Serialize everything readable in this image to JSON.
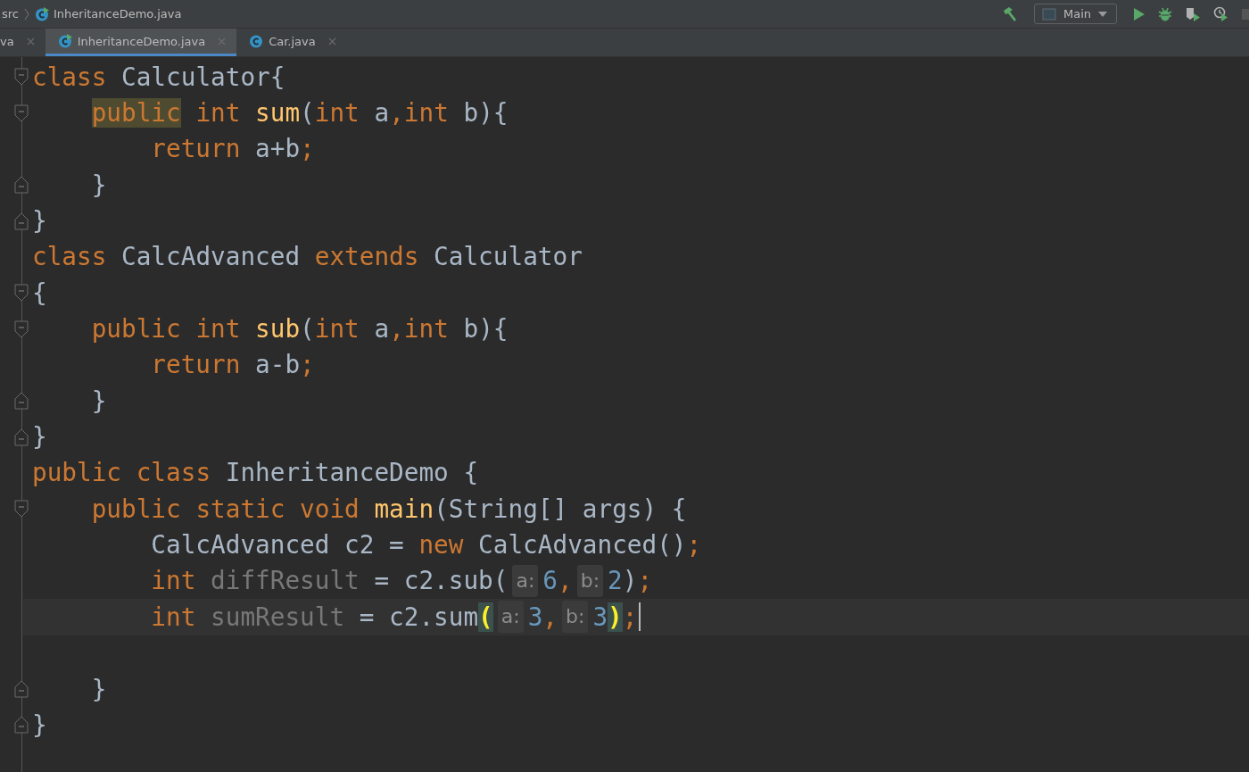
{
  "breadcrumb": [
    {
      "label": "src",
      "kind": "folder"
    },
    {
      "label": "InheritanceDemo.java",
      "kind": "main-class"
    }
  ],
  "run_config": {
    "label": "Main"
  },
  "tabs": [
    {
      "label": "va",
      "kind": "file",
      "selected": false
    },
    {
      "label": "InheritanceDemo.java",
      "kind": "main-class",
      "selected": true
    },
    {
      "label": "Car.java",
      "kind": "class",
      "selected": false
    }
  ],
  "lines": [
    {
      "fold_start": true,
      "fold_end": false,
      "current": false,
      "caret": false,
      "tokens": [
        {
          "kind": "kw",
          "t": "class"
        },
        {
          "kind": "plain",
          "t": " Calculator{"
        }
      ]
    },
    {
      "fold_start": true,
      "fold_end": false,
      "current": false,
      "caret": false,
      "tokens": [
        {
          "kind": "kw-highlight",
          "t": "    public"
        },
        {
          "kind": "kw",
          "t": " int"
        },
        {
          "kind": "method",
          "t": " sum"
        },
        {
          "kind": "plain",
          "t": "("
        },
        {
          "kind": "kw",
          "t": "int"
        },
        {
          "kind": "plain",
          "t": " a"
        },
        {
          "kind": "kw",
          "t": ","
        },
        {
          "kind": "kw",
          "t": "int"
        },
        {
          "kind": "plain",
          "t": " b){"
        }
      ]
    },
    {
      "fold_start": false,
      "fold_end": false,
      "current": false,
      "caret": false,
      "tokens": [
        {
          "kind": "kw",
          "t": "        return"
        },
        {
          "kind": "plain",
          "t": " a+b"
        },
        {
          "kind": "kw",
          "t": ";"
        }
      ]
    },
    {
      "fold_start": false,
      "fold_end": true,
      "current": false,
      "caret": false,
      "tokens": [
        {
          "kind": "plain",
          "t": "    }"
        }
      ]
    },
    {
      "fold_start": false,
      "fold_end": true,
      "current": false,
      "caret": false,
      "tokens": [
        {
          "kind": "plain",
          "t": "}"
        }
      ]
    },
    {
      "fold_start": false,
      "fold_end": false,
      "current": false,
      "caret": false,
      "tokens": [
        {
          "kind": "kw",
          "t": "class"
        },
        {
          "kind": "plain",
          "t": " CalcAdvanced"
        },
        {
          "kind": "kw",
          "t": " extends"
        },
        {
          "kind": "plain",
          "t": " Calculator"
        }
      ]
    },
    {
      "fold_start": true,
      "fold_end": false,
      "current": false,
      "caret": false,
      "tokens": [
        {
          "kind": "plain",
          "t": "{"
        }
      ]
    },
    {
      "fold_start": true,
      "fold_end": false,
      "current": false,
      "caret": false,
      "tokens": [
        {
          "kind": "kw",
          "t": "    public"
        },
        {
          "kind": "kw",
          "t": " int"
        },
        {
          "kind": "method",
          "t": " sub"
        },
        {
          "kind": "plain",
          "t": "("
        },
        {
          "kind": "kw",
          "t": "int"
        },
        {
          "kind": "plain",
          "t": " a"
        },
        {
          "kind": "kw",
          "t": ","
        },
        {
          "kind": "kw",
          "t": "int"
        },
        {
          "kind": "plain",
          "t": " b){"
        }
      ]
    },
    {
      "fold_start": false,
      "fold_end": false,
      "current": false,
      "caret": false,
      "tokens": [
        {
          "kind": "kw",
          "t": "        return"
        },
        {
          "kind": "plain",
          "t": " a-b"
        },
        {
          "kind": "kw",
          "t": ";"
        }
      ]
    },
    {
      "fold_start": false,
      "fold_end": true,
      "current": false,
      "caret": false,
      "tokens": [
        {
          "kind": "plain",
          "t": "    }"
        }
      ]
    },
    {
      "fold_start": false,
      "fold_end": true,
      "current": false,
      "caret": false,
      "tokens": [
        {
          "kind": "plain",
          "t": "}"
        }
      ]
    },
    {
      "fold_start": false,
      "fold_end": false,
      "current": false,
      "caret": false,
      "tokens": [
        {
          "kind": "kw",
          "t": "public"
        },
        {
          "kind": "kw",
          "t": " class"
        },
        {
          "kind": "plain",
          "t": " InheritanceDemo {"
        }
      ]
    },
    {
      "fold_start": true,
      "fold_end": false,
      "current": false,
      "caret": false,
      "tokens": [
        {
          "kind": "kw",
          "t": "    public"
        },
        {
          "kind": "kw",
          "t": " static"
        },
        {
          "kind": "kw",
          "t": " void"
        },
        {
          "kind": "method",
          "t": " main"
        },
        {
          "kind": "plain",
          "t": "(String[] args) {"
        }
      ]
    },
    {
      "fold_start": false,
      "fold_end": false,
      "current": false,
      "caret": false,
      "tokens": [
        {
          "kind": "plain",
          "t": "        CalcAdvanced c2 ="
        },
        {
          "kind": "kw",
          "t": " new"
        },
        {
          "kind": "plain",
          "t": " CalcAdvanced()"
        },
        {
          "kind": "kw",
          "t": ";"
        }
      ]
    },
    {
      "fold_start": false,
      "fold_end": false,
      "current": false,
      "caret": false,
      "tokens": [
        {
          "kind": "kw",
          "t": "        int"
        },
        {
          "kind": "unused",
          "t": " diffResult"
        },
        {
          "kind": "plain",
          "t": " = c2.sub("
        },
        {
          "kind": "hint",
          "t": "a:"
        },
        {
          "kind": "num",
          "t": "6"
        },
        {
          "kind": "kw",
          "t": ","
        },
        {
          "kind": "hint",
          "t": "b:"
        },
        {
          "kind": "num",
          "t": "2"
        },
        {
          "kind": "plain",
          "t": ")"
        },
        {
          "kind": "kw",
          "t": ";"
        }
      ]
    },
    {
      "fold_start": false,
      "fold_end": false,
      "current": true,
      "caret": true,
      "tokens": [
        {
          "kind": "kw",
          "t": "        int"
        },
        {
          "kind": "unused",
          "t": " sumResult"
        },
        {
          "kind": "plain",
          "t": " = c2.sum"
        },
        {
          "kind": "brace",
          "t": "("
        },
        {
          "kind": "hint",
          "t": "a:"
        },
        {
          "kind": "num",
          "t": "3"
        },
        {
          "kind": "kw",
          "t": ","
        },
        {
          "kind": "hint",
          "t": "b:"
        },
        {
          "kind": "num",
          "t": "3"
        },
        {
          "kind": "brace",
          "t": ")"
        },
        {
          "kind": "kw",
          "t": ";"
        }
      ]
    },
    {
      "fold_start": false,
      "fold_end": false,
      "current": false,
      "caret": false
    },
    {
      "fold_start": false,
      "fold_end": true,
      "current": false,
      "caret": false,
      "tokens": [
        {
          "kind": "plain",
          "t": "    }"
        }
      ]
    },
    {
      "fold_start": false,
      "fold_end": true,
      "current": false,
      "caret": false,
      "tokens": [
        {
          "kind": "plain",
          "t": "}"
        }
      ]
    }
  ]
}
